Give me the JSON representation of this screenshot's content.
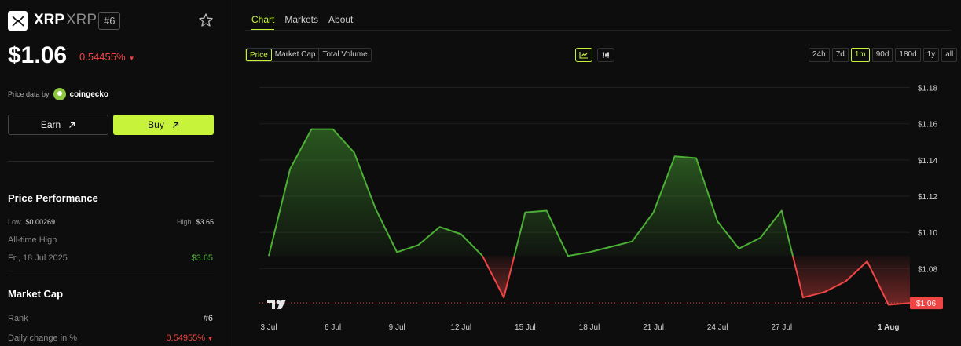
{
  "coin": {
    "name": "XRP",
    "symbol": "XRP",
    "rank_badge": "#6",
    "price": "$1.06",
    "change": "0.54455%"
  },
  "price_data": {
    "label": "Price data by",
    "source": "coingecko"
  },
  "actions": {
    "earn_label": "Earn",
    "buy_label": "Buy"
  },
  "performance": {
    "title": "Price Performance",
    "low_label": "Low",
    "low_value": "$0.00269",
    "high_label": "High",
    "high_value": "$3.65",
    "ath_label": "All-time High",
    "ath_date": "Fri, 18 Jul 2025",
    "ath_value": "$3.65"
  },
  "market_cap": {
    "title": "Market Cap",
    "rank_label": "Rank",
    "rank_value": "#6",
    "daily_label": "Daily change in %",
    "daily_value": "0.54955%"
  },
  "tabs": [
    "Chart",
    "Markets",
    "About"
  ],
  "metric_buttons": [
    "Price",
    "Market Cap",
    "Total Volume"
  ],
  "range_buttons": [
    "24h",
    "7d",
    "1m",
    "90d",
    "180d",
    "1y",
    "all"
  ],
  "active_range": "1m",
  "colors": {
    "accent": "#c7f33a",
    "up": "#4caf35",
    "down": "#f04545"
  },
  "chart_data": {
    "type": "line",
    "baseline": 1.087,
    "current_label": "$1.06",
    "x_tick_labels": [
      "3 Jul",
      "6 Jul",
      "9 Jul",
      "12 Jul",
      "15 Jul",
      "18 Jul",
      "21 Jul",
      "24 Jul",
      "27 Jul",
      "1 Aug"
    ],
    "x_tick_days": [
      3,
      6,
      9,
      12,
      15,
      18,
      21,
      24,
      27,
      32
    ],
    "y_ticks": [
      "$1.18",
      "$1.16",
      "$1.14",
      "$1.12",
      "$1.10",
      "$1.08"
    ],
    "y_tick_values": [
      1.18,
      1.16,
      1.14,
      1.12,
      1.1,
      1.08
    ],
    "ylim": [
      1.055,
      1.185
    ],
    "xlim": [
      3,
      33
    ],
    "x": [
      3,
      4,
      5,
      6,
      7,
      8,
      9,
      10,
      11,
      12,
      13,
      14,
      15,
      16,
      17,
      18,
      19,
      20,
      21,
      22,
      23,
      24,
      25,
      26,
      27,
      28,
      29,
      30,
      31,
      32,
      33
    ],
    "values": [
      1.087,
      1.135,
      1.157,
      1.157,
      1.144,
      1.113,
      1.089,
      1.093,
      1.103,
      1.099,
      1.087,
      1.064,
      1.111,
      1.112,
      1.087,
      1.089,
      1.092,
      1.095,
      1.111,
      1.142,
      1.141,
      1.106,
      1.091,
      1.097,
      1.112,
      1.064,
      1.067,
      1.073,
      1.084,
      1.06,
      1.061
    ]
  }
}
